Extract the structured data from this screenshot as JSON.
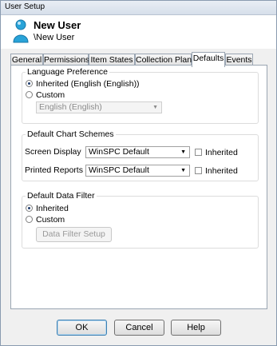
{
  "window": {
    "title": "User Setup"
  },
  "header": {
    "title": "New User",
    "subtitle": "\\New User",
    "icon": "user-icon"
  },
  "tabs": [
    {
      "label": "General",
      "active": false
    },
    {
      "label": "Permissions",
      "active": false
    },
    {
      "label": "Item States",
      "active": false
    },
    {
      "label": "Collection Plans",
      "active": false
    },
    {
      "label": "Defaults",
      "active": true
    },
    {
      "label": "Events",
      "active": false
    }
  ],
  "language": {
    "legend": "Language Preference",
    "inherited_label": "Inherited (English (English))",
    "inherited_selected": true,
    "custom_label": "Custom",
    "custom_selected": false,
    "custom_value": "English (English)"
  },
  "chart_schemes": {
    "legend": "Default Chart Schemes",
    "rows": [
      {
        "label": "Screen Display",
        "value": "WinSPC Default",
        "inherited_label": "Inherited",
        "inherited_checked": false
      },
      {
        "label": "Printed Reports",
        "value": "WinSPC Default",
        "inherited_label": "Inherited",
        "inherited_checked": false
      }
    ]
  },
  "data_filter": {
    "legend": "Default Data Filter",
    "inherited_label": "Inherited",
    "inherited_selected": true,
    "custom_label": "Custom",
    "custom_selected": false,
    "setup_button": "Data Filter Setup"
  },
  "footer": {
    "ok": "OK",
    "cancel": "Cancel",
    "help": "Help"
  },
  "colors": {
    "accent": "#3c7fb1",
    "panel": "#ffffff",
    "background": "#f0f0f0"
  }
}
